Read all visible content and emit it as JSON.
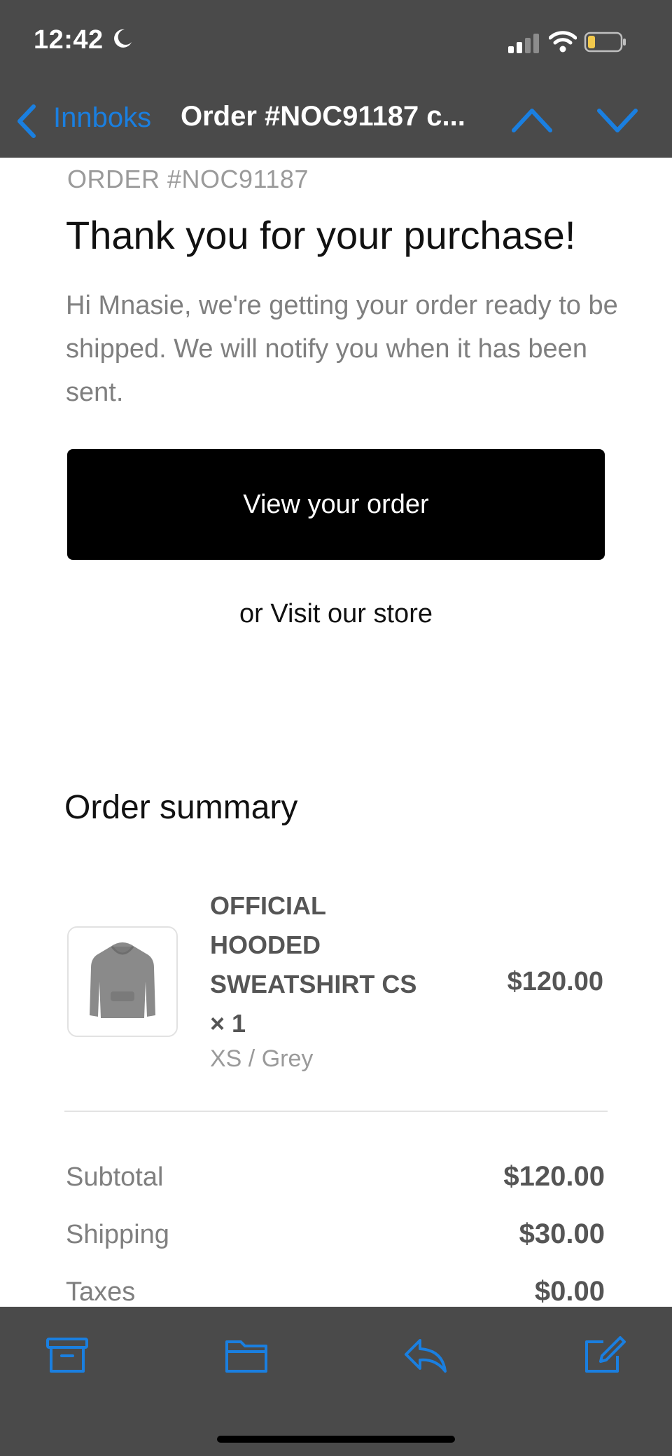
{
  "status_bar": {
    "time": "12:42"
  },
  "nav": {
    "back_label": "Innboks",
    "title": "Order #NOC91187 c..."
  },
  "email": {
    "order_id": "ORDER #NOC91187",
    "headline": "Thank you for your purchase!",
    "intro": "Hi Mnasie, we're getting your order ready to be shipped. We will notify you when it has been sent.",
    "view_order_button": "View your order",
    "visit_store": "or Visit our store",
    "summary_title": "Order summary",
    "item": {
      "name": "OFFICIAL HOODED SWEATSHIRT CS × 1",
      "variant": "XS / Grey",
      "price": "$120.00"
    },
    "totals": [
      {
        "label": "Subtotal",
        "value": "$120.00"
      },
      {
        "label": "Shipping",
        "value": "$30.00"
      },
      {
        "label": "Taxes",
        "value": "$0.00"
      }
    ]
  },
  "colors": {
    "accent": "#1a7fe0",
    "bar_background": "#4a4a4a",
    "button_background": "#000000"
  },
  "toolbar": {
    "icons": [
      "archive-icon",
      "folder-icon",
      "reply-icon",
      "compose-icon"
    ]
  }
}
